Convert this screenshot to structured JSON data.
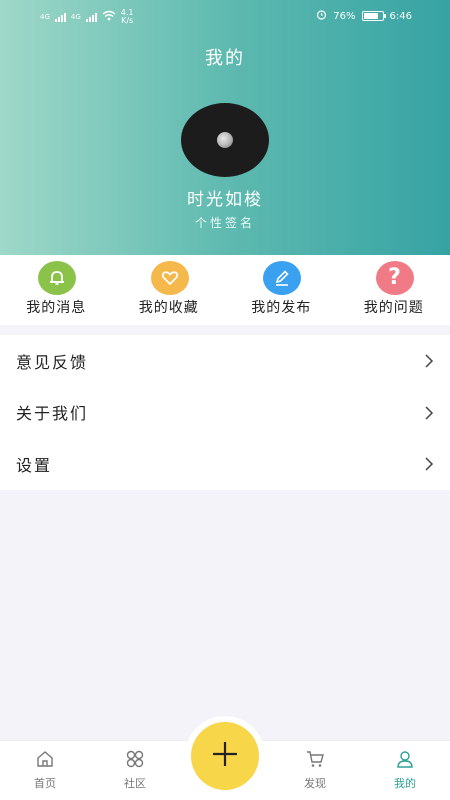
{
  "status_bar": {
    "network_left": "4G",
    "network_right": "4G",
    "speed_value": "4.1",
    "speed_unit": "K/s",
    "battery": "76%",
    "time": "6:46"
  },
  "header": {
    "title": "我的",
    "nickname": "时光如梭",
    "signature": "个性签名"
  },
  "quick_actions": [
    {
      "label": "我的消息",
      "icon": "bell-icon",
      "color": "#8bc34a"
    },
    {
      "label": "我的收藏",
      "icon": "heart-icon",
      "color": "#f5b84a"
    },
    {
      "label": "我的发布",
      "icon": "pencil-icon",
      "color": "#3aa0f0"
    },
    {
      "label": "我的问题",
      "icon": "question-icon",
      "color": "#f07a86"
    }
  ],
  "menu": [
    {
      "label": "意见反馈"
    },
    {
      "label": "关于我们"
    },
    {
      "label": "设置"
    }
  ],
  "bottom_nav": {
    "items": [
      {
        "label": "首页",
        "icon": "home-icon"
      },
      {
        "label": "社区",
        "icon": "grid-icon"
      },
      {
        "label": "发现",
        "icon": "cart-icon"
      },
      {
        "label": "我的",
        "icon": "user-icon",
        "active": true
      }
    ],
    "fab_icon": "plus-icon",
    "accent_color": "#2ea198",
    "fab_color": "#f7d64a"
  }
}
